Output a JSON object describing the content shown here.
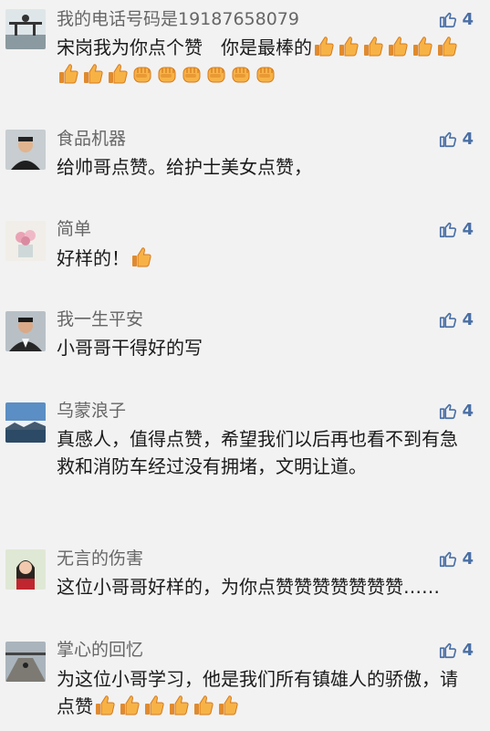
{
  "like_color": "#4a6fa5",
  "comments": [
    {
      "name": "我的电话号码是19187658079",
      "likes": "4",
      "text": "宋岗我为你点个赞　你是最棒的",
      "emoji": [
        "thumbs-up",
        "thumbs-up",
        "thumbs-up",
        "thumbs-up",
        "thumbs-up",
        "thumbs-up",
        "thumbs-up",
        "thumbs-up",
        "thumbs-up",
        "fist",
        "fist",
        "fist",
        "fist",
        "fist",
        "fist"
      ]
    },
    {
      "name": "食品机器",
      "likes": "4",
      "text": "给帅哥点赞。给护士美女点赞，",
      "emoji": []
    },
    {
      "name": "简单",
      "likes": "4",
      "text": "好样的！",
      "emoji": [
        "thumbs-up"
      ]
    },
    {
      "name": "我一生平安",
      "likes": "4",
      "text": "小哥哥干得好的写",
      "emoji": []
    },
    {
      "name": "乌蒙浪子",
      "likes": "4",
      "text": "真感人，值得点赞，希望我们以后再也看不到有急救和消防车经过没有拥堵，文明让道。",
      "emoji": []
    },
    {
      "name": "无言的伤害",
      "likes": "4",
      "text": "这位小哥哥好样的，为你点赞赞赞赞赞赞赞……",
      "emoji": []
    },
    {
      "name": "掌心的回忆",
      "likes": "4",
      "text": "为这位小哥学习，他是我们所有镇雄人的骄傲，请点赞",
      "emoji": [
        "thumbs-up",
        "thumbs-up",
        "thumbs-up",
        "thumbs-up",
        "thumbs-up",
        "thumbs-up"
      ]
    }
  ]
}
